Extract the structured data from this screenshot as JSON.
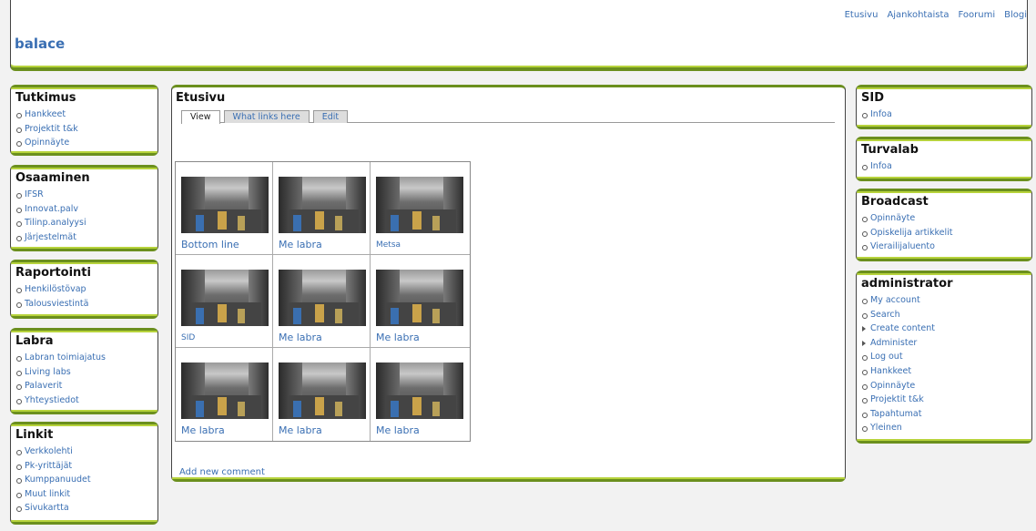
{
  "header": {
    "site_name": "balace",
    "primary_links": [
      "Etusivu",
      "Ajankohtaista",
      "Foorumi",
      "Blogi"
    ]
  },
  "left_sidebar": [
    {
      "title": "Tutkimus",
      "items": [
        "Hankkeet",
        "Projektit t&k",
        "Opinnäyte"
      ]
    },
    {
      "title": "Osaaminen",
      "items": [
        "IFSR",
        "Innovat.palv",
        "Tilinp.analyysi",
        "Järjestelmät"
      ]
    },
    {
      "title": "Raportointi",
      "items": [
        "Henkilöstövap",
        "Talousviestintä"
      ]
    },
    {
      "title": "Labra",
      "items": [
        "Labran toimiajatus",
        "Living labs",
        "Palaverit",
        "Yhteystiedot"
      ]
    },
    {
      "title": "Linkit",
      "items": [
        "Verkkolehti",
        "Pk-yrittäjät",
        "Kumppanuudet",
        "Muut linkit",
        "Sivukartta"
      ]
    }
  ],
  "main": {
    "title": "Etusivu",
    "tabs": [
      "View",
      "What links here",
      "Edit"
    ],
    "active_tab": "View",
    "gallery": [
      {
        "caption": "Bottom line"
      },
      {
        "caption": "Me labra"
      },
      {
        "caption": "Metsa"
      },
      {
        "caption": "SID"
      },
      {
        "caption": "Me labra"
      },
      {
        "caption": "Me labra"
      },
      {
        "caption": "Me labra"
      },
      {
        "caption": "Me labra"
      },
      {
        "caption": "Me labra"
      }
    ],
    "add_comment": "Add new comment"
  },
  "right_sidebar": [
    {
      "title": "SID",
      "items": [
        "Infoa"
      ]
    },
    {
      "title": "Turvalab",
      "items": [
        "Infoa"
      ]
    },
    {
      "title": "Broadcast",
      "items": [
        "Opinnäyte",
        "Opiskelija artikkelit",
        "Vierailijaluento"
      ]
    },
    {
      "title": "administrator",
      "items": [
        "My account",
        "Search",
        "Create content",
        "Administer",
        "Log out",
        "Hankkeet",
        "Opinnäyte",
        "Projektit t&k",
        "Tapahtumat",
        "Yleinen"
      ]
    }
  ]
}
